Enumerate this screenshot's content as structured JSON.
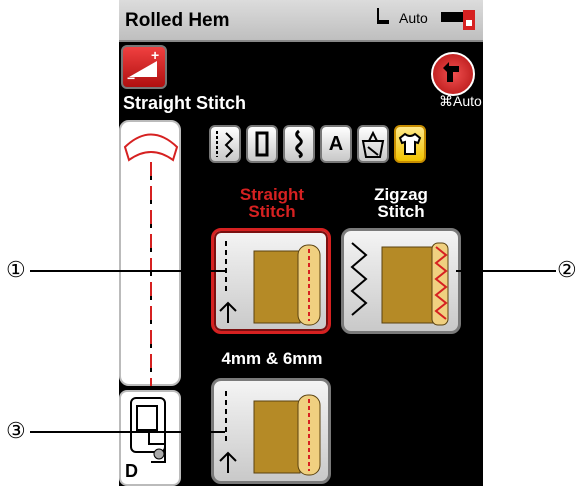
{
  "header": {
    "title": "Rolled Hem",
    "auto_label": "Auto"
  },
  "status": {
    "mode_label": "Straight Stitch",
    "auto_label": "Auto"
  },
  "categories": [
    {
      "name": "utility-stitches-icon"
    },
    {
      "name": "buttonhole-icon"
    },
    {
      "name": "decorative-stitches-icon"
    },
    {
      "name": "letters-icon",
      "label": "A"
    },
    {
      "name": "quilting-icon"
    },
    {
      "name": "garment-icon",
      "selected": true
    }
  ],
  "stitches": [
    {
      "label_line1": "Straight",
      "label_line2": "Stitch",
      "selected": true
    },
    {
      "label_line1": "Zigzag",
      "label_line2": "Stitch",
      "selected": false
    },
    {
      "label_line1": "4mm & 6mm",
      "label_line2": "",
      "selected": false
    }
  ],
  "foot": {
    "letter": "D"
  },
  "callouts": [
    "①",
    "②",
    "③"
  ],
  "colors": {
    "selected": "#d62121",
    "accent_yellow": "#f2c300",
    "fabric": "#b58a26"
  }
}
